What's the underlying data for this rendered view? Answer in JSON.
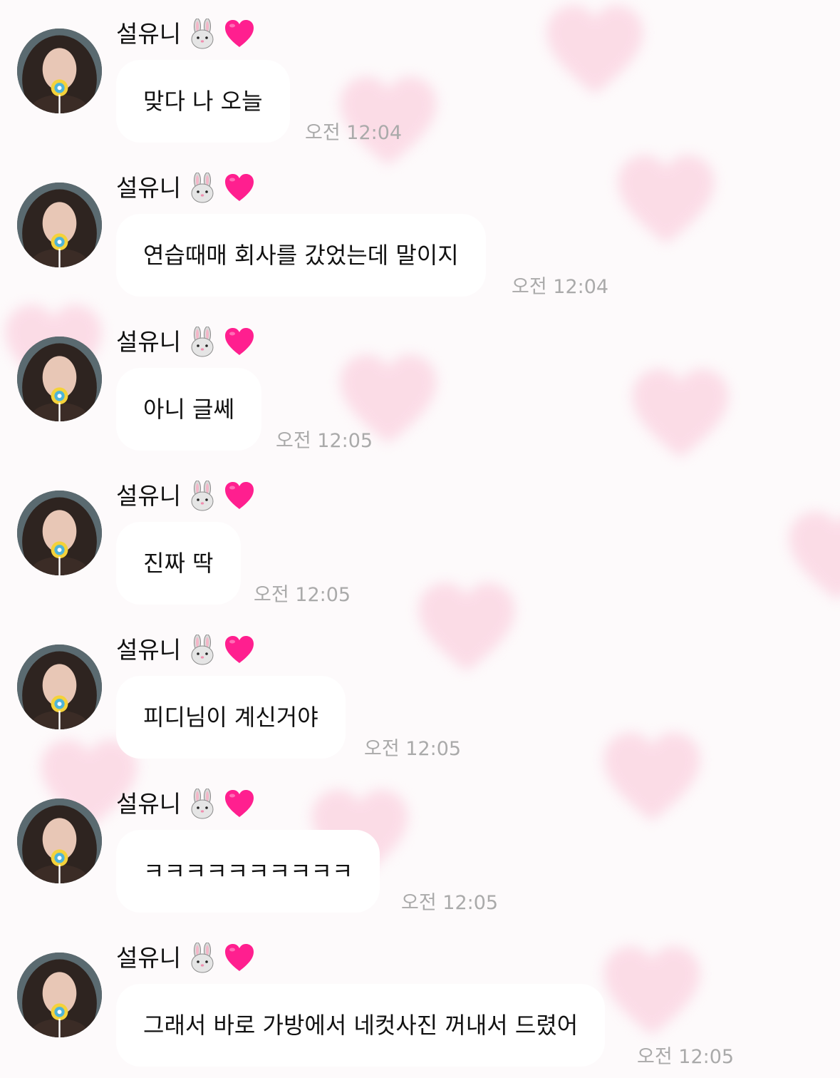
{
  "sender": {
    "name": "설유니",
    "emojis": [
      "rabbit-face-icon",
      "pink-heart-icon"
    ]
  },
  "messages": [
    {
      "text": "맞다 나 오늘",
      "time": "오전 12:04"
    },
    {
      "text": "연습때매 회사를 갔었는데 말이지",
      "time": "오전 12:04"
    },
    {
      "text": "아니 글쎄",
      "time": "오전 12:05"
    },
    {
      "text": "진짜 딱",
      "time": "오전 12:05"
    },
    {
      "text": "피디님이 계신거야",
      "time": "오전 12:05"
    },
    {
      "text": "ㅋㅋㅋㅋㅋㅋㅋㅋㅋㅋ",
      "time": "오전 12:05"
    },
    {
      "text": "그래서 바로 가방에서 네컷사진 꺼내서 드렸어",
      "time": "오전 12:05"
    }
  ],
  "colors": {
    "background": "#fdfafb",
    "bubble": "#ffffff",
    "heart_pattern": "#fbd2e0",
    "emoji_heart": "#ff1f8f",
    "timestamp": "#aaaaaa"
  }
}
